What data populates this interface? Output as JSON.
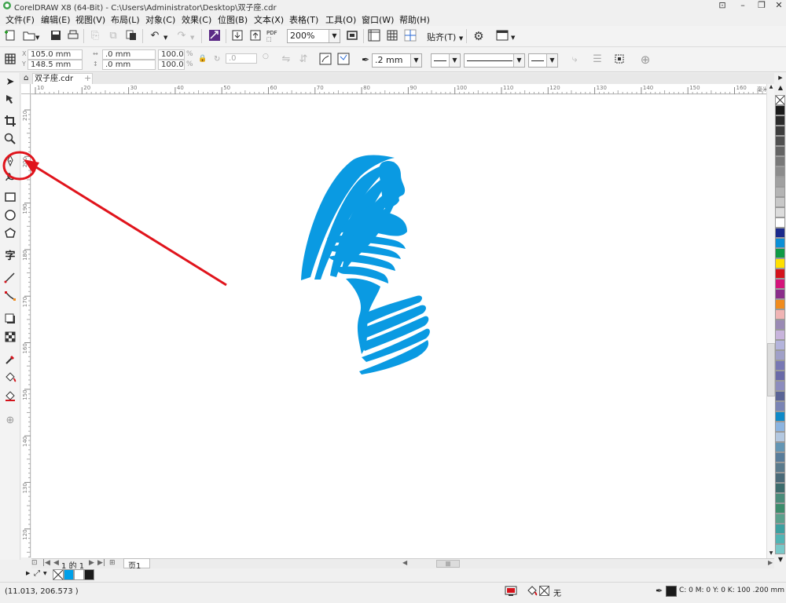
{
  "window": {
    "title": "CorelDRAW X8 (64-Bit) - C:\\Users\\Administrator\\Desktop\\双子座.cdr",
    "controls": [
      "⊡",
      "–",
      "❐",
      "✕"
    ]
  },
  "menu": [
    "文件(F)",
    "编辑(E)",
    "视图(V)",
    "布局(L)",
    "对象(C)",
    "效果(C)",
    "位图(B)",
    "文本(X)",
    "表格(T)",
    "工具(O)",
    "窗口(W)",
    "帮助(H)"
  ],
  "std_toolbar": {
    "zoom": "200%",
    "snap_label": "贴齐(T)",
    "pdf_label": "PDF"
  },
  "prop_bar": {
    "x": "105.0 mm",
    "y": "148.5 mm",
    "width": ".0 mm",
    "height": ".0 mm",
    "scale_w": "100.0",
    "scale_h": "100.0",
    "pct": "%",
    "angle": ".0",
    "outline_width": ".2 mm"
  },
  "document_tab": {
    "name": "双子座.cdr"
  },
  "rulers": {
    "h_ticks": [
      "10",
      "20",
      "30",
      "40",
      "50",
      "60",
      "70",
      "80",
      "90",
      "100",
      "110",
      "120",
      "130",
      "140",
      "150",
      "160"
    ],
    "h_unit": "毫米",
    "v_ticks": [
      "210",
      "200",
      "190",
      "180",
      "170",
      "160",
      "150",
      "140",
      "130",
      "120"
    ]
  },
  "palette_colors": [
    "#1a1a1a",
    "#2b2b2b",
    "#3d3d3d",
    "#505050",
    "#646464",
    "#787878",
    "#8c8c8c",
    "#a0a0a0",
    "#b4b4b4",
    "#c8c8c8",
    "#dcdcdc",
    "#ffffff",
    "#1b2a8c",
    "#0b8fd6",
    "#0e9a46",
    "#ffe000",
    "#d4141c",
    "#d4147a",
    "#8a2d8a",
    "#f08c1e",
    "#f0b4b4",
    "#9a8ab4",
    "#c8b4dc",
    "#b4b4dc",
    "#a0a0c8",
    "#7878b4",
    "#6a6aa8",
    "#8c8cbe",
    "#5a6496",
    "#7a84b4",
    "#0f8ac8",
    "#8cb4e0",
    "#b4c8e0",
    "#6496b4",
    "#587c9a",
    "#5a7a8c",
    "#4a6a78",
    "#3c6c6c",
    "#4a8c7a",
    "#3c8c6c",
    "#5aa08c",
    "#3ca0a0",
    "#50b4b4",
    "#78c8c8"
  ],
  "page_nav": {
    "current": "1",
    "of_label": "的",
    "total": "1",
    "page_tab": "页1"
  },
  "doc_palette": [
    "#00a0e9",
    "#ffffff",
    "#1a1a1a"
  ],
  "status": {
    "coords": "(11.013, 206.573 )",
    "fill_none": "无",
    "outline_spec": "C: 0 M: 0 Y: 0 K: 100  .200 mm"
  },
  "artwork": {
    "fill": "#0a9ae2"
  }
}
